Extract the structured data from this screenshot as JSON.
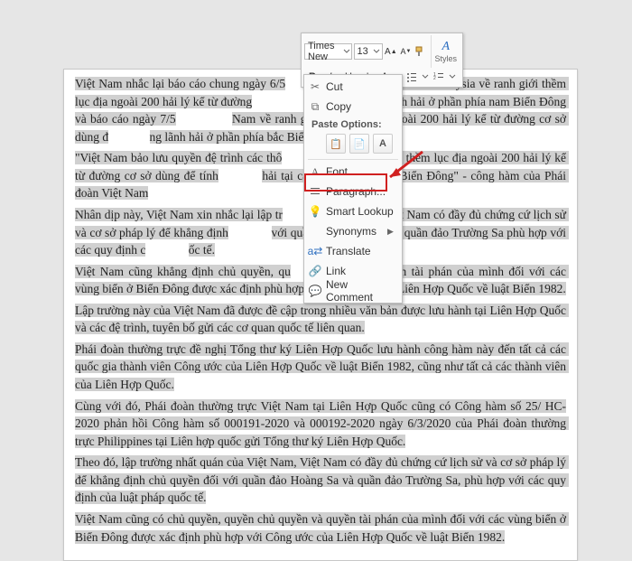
{
  "minibar": {
    "font_name": "Times New",
    "font_size": "13",
    "styles_label": "Styles"
  },
  "context_menu": {
    "cut": "Cut",
    "copy": "Copy",
    "paste_options_header": "Paste Options:",
    "font": "Font...",
    "paragraph": "Paragraph...",
    "smart_lookup": "Smart Lookup",
    "synonyms": "Synonyms",
    "translate": "Translate",
    "link": "Link",
    "new_comment": "New Comment"
  },
  "document": {
    "p1a": "Việt Nam nhắc lại báo cáo chung ngày 6/5",
    "p1b": "Việt Nam và Malaysia về ranh giới thềm lục địa ngoài 200 hải lý kể từ đường",
    "p1c": "tính chiều rộng lãnh hải ở phần phía nam Biển Đông và báo cáo ngày 7/5",
    "p1d": "Nam về ranh giới thềm lục địa ngoài 200 hải lý kể từ đường cơ sở dùng đ",
    "p1e": "ng lãnh hải ở phần phía bắc Biển Đông.",
    "p2a": "\"Việt Nam bảo lưu quyền đệ trình các thô",
    "p2b": "ranh giới thềm lục địa ngoài 200 hải lý kể từ đường cơ sở dùng để tính",
    "p2c": "hải tại các khu vực khác ở Biển Đông\" - công hàm của Phái đoàn Việt Nam",
    "p3a": "Nhân dịp này, Việt Nam xin nhắc lại lập tr",
    "p3b": "rằng Việt Nam có đầy đủ chứng cứ lịch sử và cơ sở pháp lý để khẳng định",
    "p3c": "với quần đảo Hoàng Sa và quần đảo Trường Sa phù hợp với các quy định c",
    "p3d": "ốc tế.",
    "p4a": "Việt Nam cũng khẳng định chủ quyền, qu",
    "p4b": "à quyền tài phán của mình đối với các vùng biển ở Biển Đông được xác định phù hợp với Công ước của Liên Hợp Quốc về luật Biển 1982.",
    "p5": "Lập trường này của Việt Nam đã được đề cập trong nhiều văn bản được lưu hành tại Liên Hợp Quốc và các đệ trình, tuyên bố gửi các cơ quan quốc tế liên quan.",
    "p6": "Phái đoàn thường trực đề nghị Tổng thư ký Liên Hợp Quốc lưu hành công hàm này đến tất cả các quốc gia thành viên Công ước của Liên Hợp Quốc về luật Biển 1982, cũng như tất cả các thành viên của Liên Hợp Quốc.",
    "p7": "Cùng với đó, Phái đoàn thường trực Việt Nam tại Liên Hợp Quốc cũng có Công hàm số 25/ HC-2020 phản hồi Công hàm số 000191-2020 và 000192-2020 ngày 6/3/2020 của Phái đoàn thường trực Philippines tại Liên hợp quốc gửi Tổng thư ký Liên Hợp Quốc.",
    "p8": "Theo đó, lập trường nhất quán của Việt Nam, Việt Nam có đầy đủ chứng cứ lịch sử và cơ sở pháp lý để khẳng định chủ quyền đối với quần đảo Hoàng Sa và quần đảo Trường Sa, phù hợp với các quy định của luật pháp quốc tế.",
    "p9": "Việt Nam cũng có chủ quyền, quyền chủ quyền và quyền tài phán của mình đối với các vùng biển ở Biển Đông được xác định phù hợp với Công ước của Liên Hợp Quốc về luật Biển 1982."
  }
}
